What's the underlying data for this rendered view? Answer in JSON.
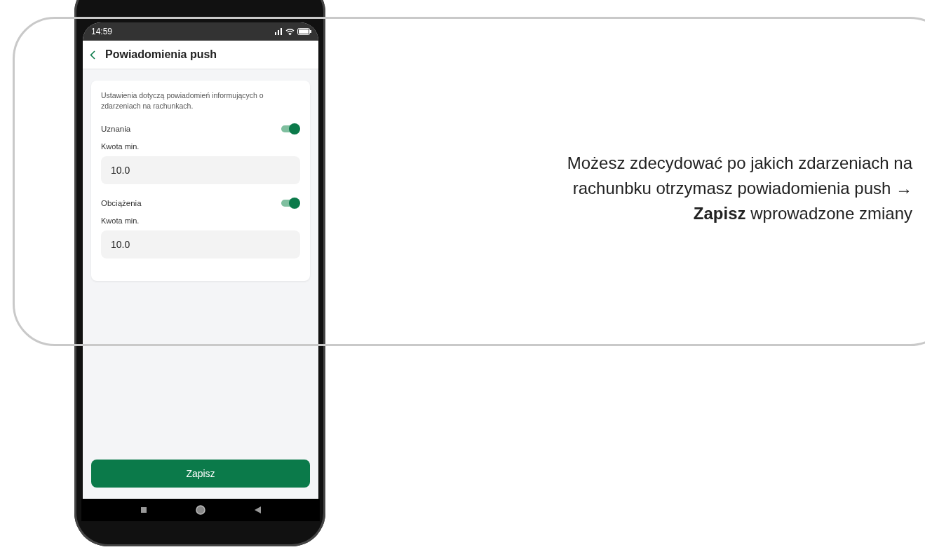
{
  "status_bar": {
    "time": "14:59"
  },
  "header": {
    "title": "Powiadomienia push"
  },
  "card": {
    "description": "Ustawienia dotyczą powiadomień informujących o zdarzeniach na rachunkach.",
    "settings": [
      {
        "label": "Uznania",
        "on": true,
        "field_label": "Kwota min.",
        "value": "10.0"
      },
      {
        "label": "Obciążenia",
        "on": true,
        "field_label": "Kwota min.",
        "value": "10.0"
      }
    ]
  },
  "save_button": "Zapisz",
  "caption": "Możesz zdecydować po jakich zdarzeniach na rachunbku otrzymasz powiadomienia push → **Zapisz** wprowadzone zmiany"
}
